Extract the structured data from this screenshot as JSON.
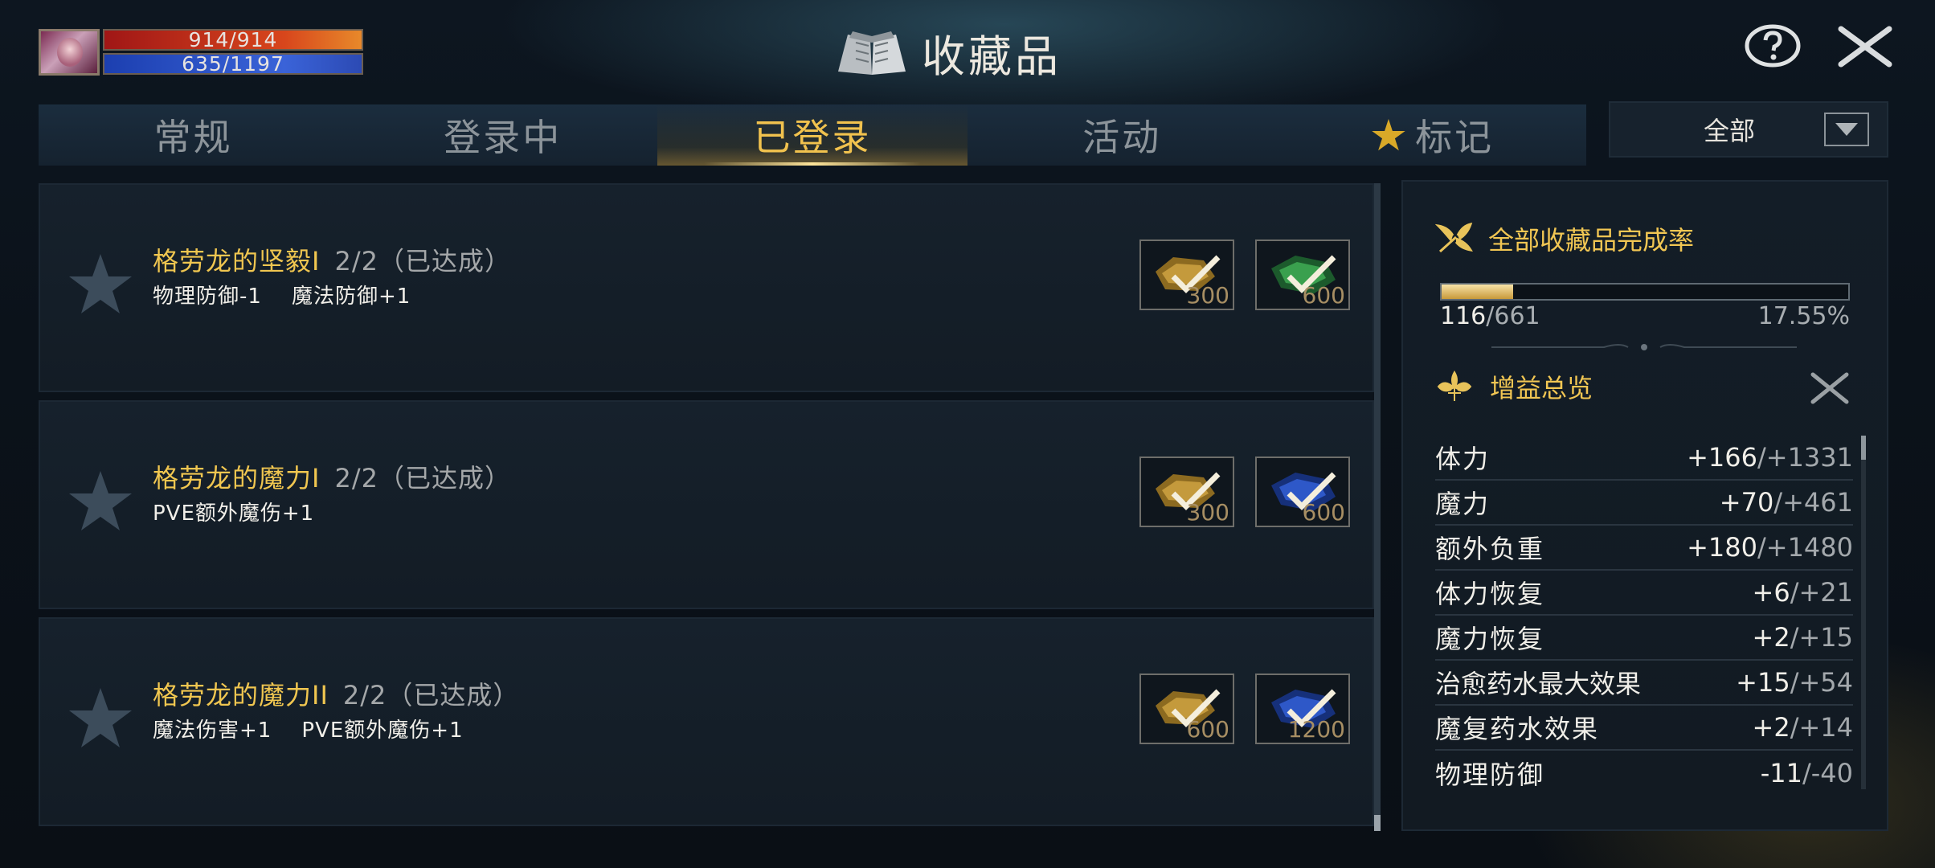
{
  "player": {
    "hp": "914/914",
    "mp": "635/1197"
  },
  "header": {
    "title": "收藏品"
  },
  "tabs": [
    {
      "label": "常规"
    },
    {
      "label": "登录中"
    },
    {
      "label": "已登录",
      "active": true
    },
    {
      "label": "活动"
    },
    {
      "label": "标记",
      "icon": "star-icon"
    }
  ],
  "filter": {
    "selected": "全部"
  },
  "collections": [
    {
      "name": "格劳龙的坚毅I",
      "count": "2/2（已达成）",
      "effects": "物理防御-1    魔法防御+1",
      "rewards": [
        {
          "icon": "gold-ore-icon",
          "amount": "300"
        },
        {
          "icon": "green-gem-icon",
          "amount": "600"
        }
      ]
    },
    {
      "name": "格劳龙的魔力I",
      "count": "2/2（已达成）",
      "effects": "PVE额外魔伤+1",
      "rewards": [
        {
          "icon": "gold-ore-icon",
          "amount": "300"
        },
        {
          "icon": "blue-gem-icon",
          "amount": "600"
        }
      ]
    },
    {
      "name": "格劳龙的魔力II",
      "count": "2/2（已达成）",
      "effects": "魔法伤害+1    PVE额外魔伤+1",
      "rewards": [
        {
          "icon": "gold-ore-icon",
          "amount": "600"
        },
        {
          "icon": "blue-gem-icon",
          "amount": "1200"
        }
      ]
    }
  ],
  "completion": {
    "title": "全部收藏品完成率",
    "collected": "116",
    "total": "/661",
    "percent": "17.55%",
    "fraction": 0.1755
  },
  "buffs": {
    "title": "增益总览",
    "rows": [
      {
        "label": "体力",
        "current": "+166",
        "total": "/+1331"
      },
      {
        "label": "魔力",
        "current": "+70",
        "total": "/+461"
      },
      {
        "label": "额外负重",
        "current": "+180",
        "total": "/+1480"
      },
      {
        "label": "体力恢复",
        "current": "+6",
        "total": "/+21"
      },
      {
        "label": "魔力恢复",
        "current": "+2",
        "total": "/+15"
      },
      {
        "label": "治愈药水最大效果",
        "current": "+15",
        "total": "/+54"
      },
      {
        "label": "魔复药水效果",
        "current": "+2",
        "total": "/+14"
      },
      {
        "label": "物理防御",
        "current": "-11",
        "total": "/-40"
      }
    ]
  },
  "colors": {
    "accent": "#f1c24e",
    "hp": "#d8461c",
    "mp": "#3a63d8"
  }
}
